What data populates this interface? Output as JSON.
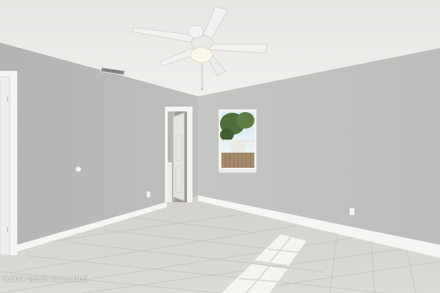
{
  "photo": {
    "watermark": "©2024 Space Coast MLS"
  },
  "colors": {
    "ceiling": "#ebeae7",
    "left_wall": "#b7b8b5",
    "right_wall": "#c3c4c1",
    "floor": "#d9d8d3",
    "trim": "#f5f5f3",
    "fan": "#f2f2f0"
  }
}
